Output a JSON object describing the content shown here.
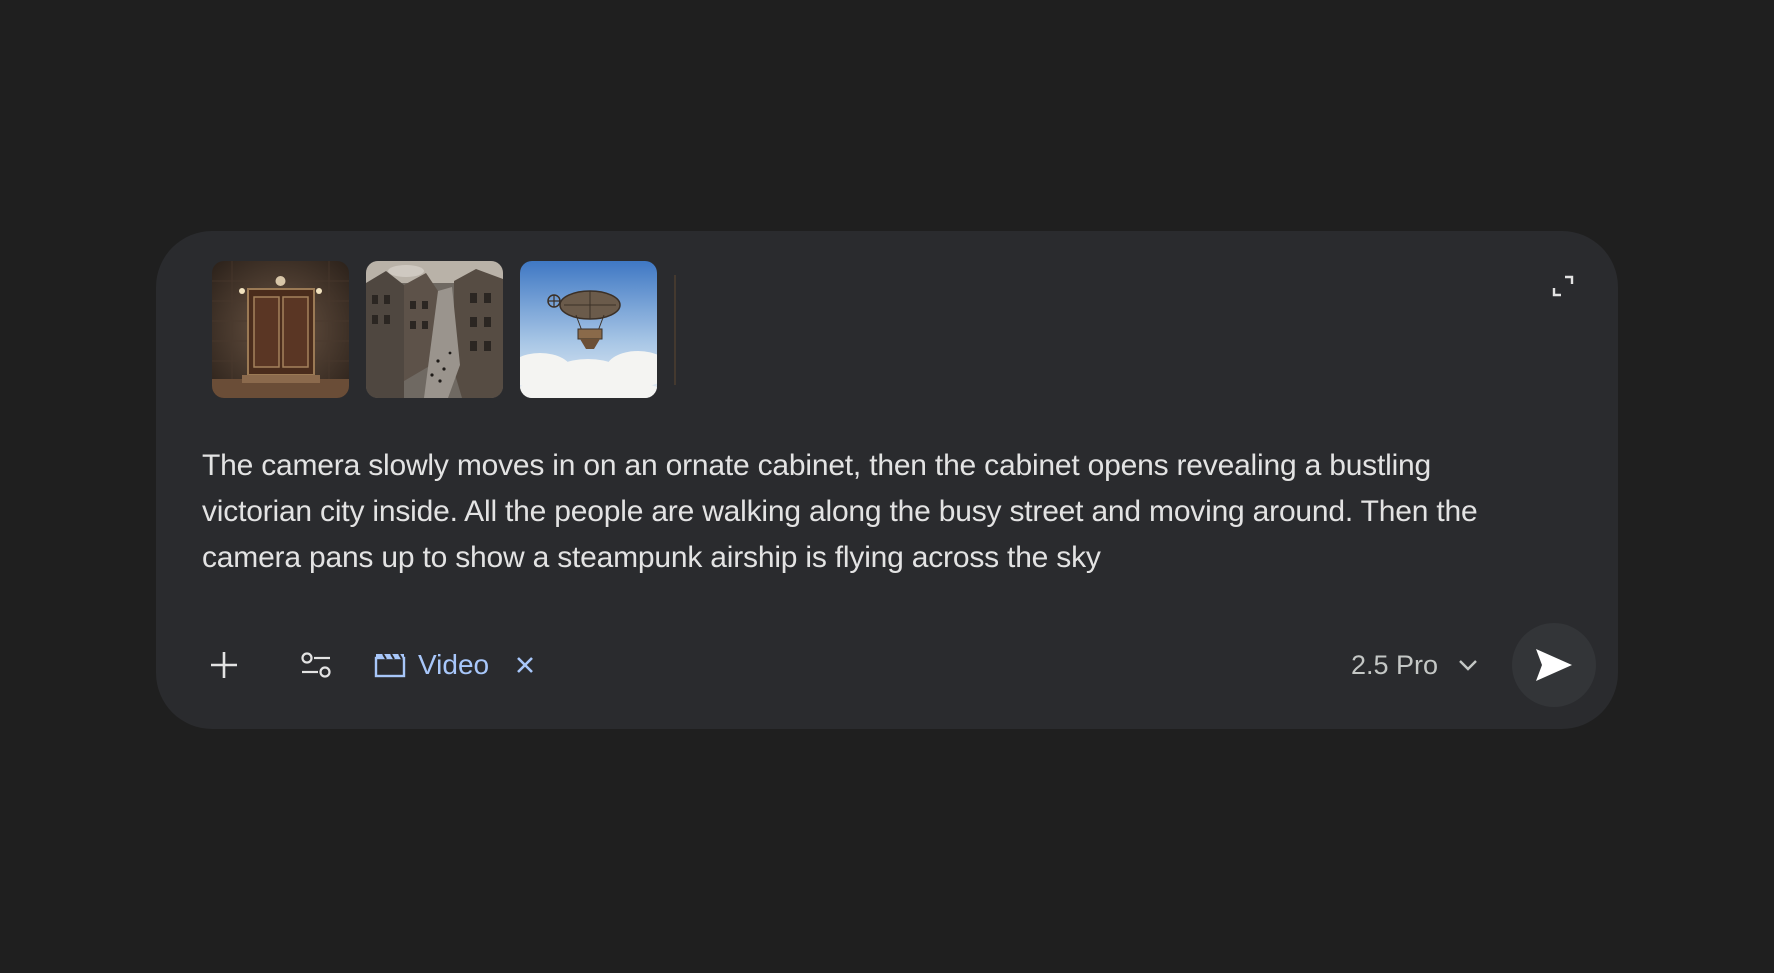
{
  "composer": {
    "attachments": [
      {
        "name": "cabinet-image",
        "subject": "ornate cabinet"
      },
      {
        "name": "victorian-city-image",
        "subject": "victorian city street"
      },
      {
        "name": "airship-image",
        "subject": "steampunk airship above clouds"
      }
    ],
    "prompt_text": "The camera slowly moves in on an ornate cabinet, then the cabinet opens revealing a bustling victorian city inside. All the people are walking along the busy street and moving around. Then the camera pans up to show a steampunk airship is flying across the sky",
    "expand_icon": "expand-icon"
  },
  "toolbar": {
    "add_icon": "plus-icon",
    "tools_icon": "tune-icon",
    "video_chip": {
      "icon": "clapperboard-icon",
      "label": "Video",
      "close_icon": "close-icon"
    },
    "model": {
      "label": "2.5 Pro",
      "chevron_icon": "chevron-down-icon"
    },
    "send_icon": "send-icon"
  },
  "colors": {
    "page_background": "#1f1f1f",
    "composer_background": "#2a2b2e",
    "text": "#e3e3e3",
    "accent": "#a8c7fa",
    "send_background": "#333538"
  }
}
